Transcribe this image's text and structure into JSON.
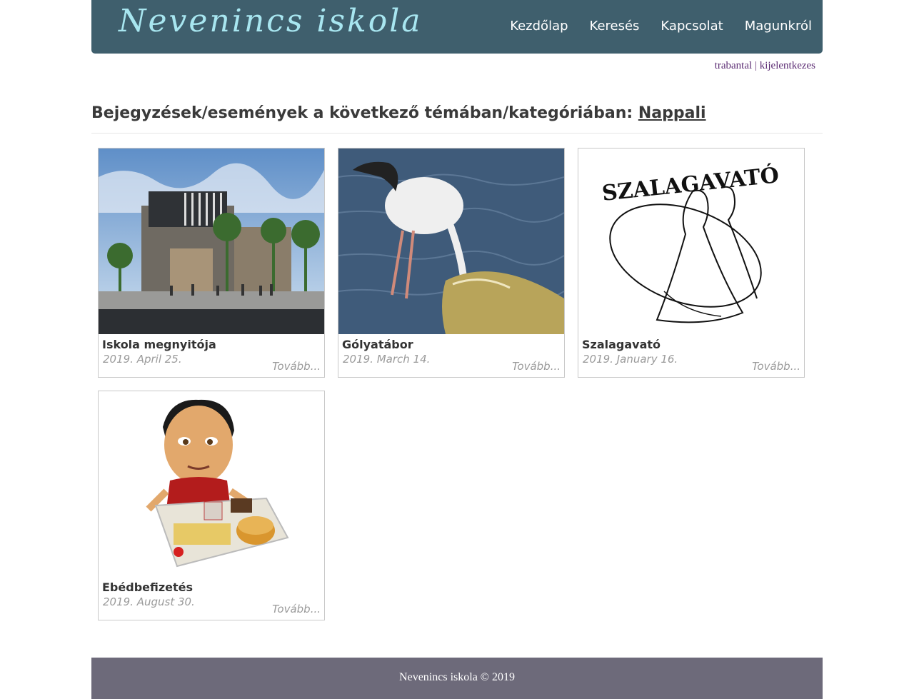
{
  "header": {
    "logo": "Nevenincs iskola",
    "nav": [
      "Kezdőlap",
      "Keresés",
      "Kapcsolat",
      "Magunkról"
    ]
  },
  "user": {
    "username": "trabantal",
    "separator": "|",
    "logout": "kijelentkezes"
  },
  "heading": {
    "prefix": "Bejegyzések/események a következő témában/kategóriában:",
    "category": "Nappali"
  },
  "posts": [
    {
      "title": "Iskola megnyitója",
      "date": "2019. April 25.",
      "more": "Tovább...",
      "image": "school-building-image"
    },
    {
      "title": "Gólyatábor",
      "date": "2019. March 14.",
      "more": "Tovább...",
      "image": "stork-crocodile-image"
    },
    {
      "title": "Szalagavató",
      "date": "2019. January 16.",
      "more": "Tovább...",
      "image": "ball-dancers-image",
      "image_text": "SZALAGAVATÓ"
    },
    {
      "title": "Ebédbefizetés",
      "date": "2019. August 30.",
      "more": "Tovább...",
      "image": "boy-lunch-tray-image"
    }
  ],
  "footer": {
    "text": "Nevenincs iskola © 2019"
  },
  "colors": {
    "header_bg": "#3f5f6d",
    "logo": "#a8e6f0",
    "footer_bg": "#6d6a7a"
  }
}
